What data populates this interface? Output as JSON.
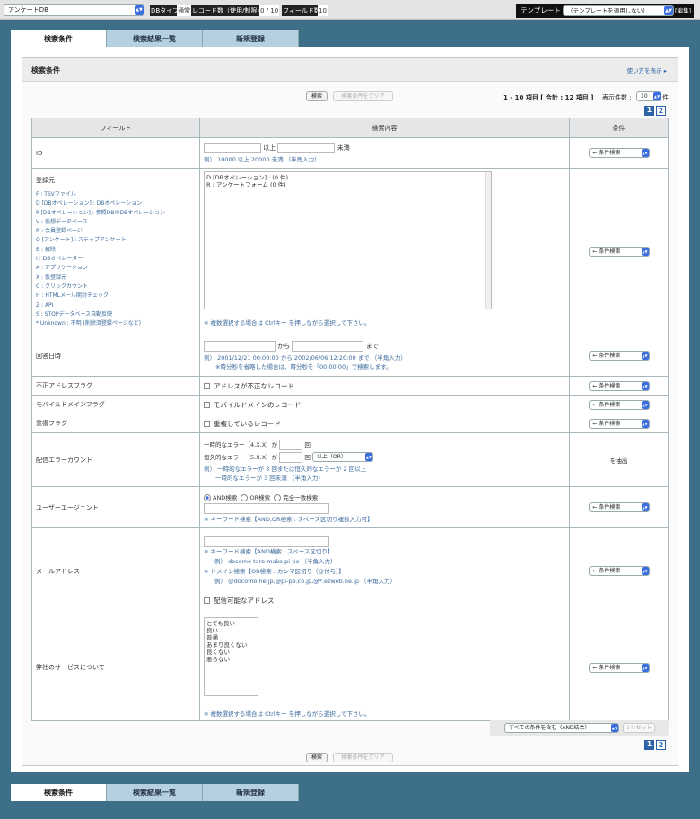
{
  "topbar": {
    "db_select": "アンケートDB",
    "db_type_label": "DBタイプ",
    "db_type_value": "通常",
    "record_count_label": "レコード数（使用/制限）",
    "record_count_value": "0 / 10",
    "field_count_label": "フィールド数",
    "field_count_value": "10",
    "template_label": "テンプレート",
    "template_select": "（テンプレートを適用しない）",
    "edit_label": "[編集]"
  },
  "tabs": [
    "検索条件",
    "検索結果一覧",
    "新規登録"
  ],
  "panel": {
    "title": "検索条件",
    "help_link": "使い方を表示 ▸",
    "search_button": "検索",
    "clear_button": "検索条件をクリア",
    "pager_summary": "1 - 10 項目 [ 合計 : 12 項目 ]",
    "display_count_label": "表示件数 :",
    "display_count_value": "10",
    "display_count_unit": "件",
    "pages": [
      "1",
      "2"
    ]
  },
  "table": {
    "headers": [
      "フィールド",
      "検索内容",
      "条件"
    ],
    "condition_search": "← 条件検索",
    "rows": {
      "id": {
        "label": "ID",
        "from_suffix": "以上",
        "to_suffix": "未満",
        "example": "例）  10000 以上 20000 未満 （半角入力）"
      },
      "source": {
        "label": "登録元",
        "legend": [
          "F : TSVファイル",
          "D [DBオペレーション] : DBオペレーション",
          "P [DBオペレーション] : 参照DBのDBオペレーション",
          "V : 仮想データベース",
          "R : 会員登録ページ",
          "Q [アンケート] : ステップアンケート",
          "B : 解除",
          "I : DBオペレーター",
          "A : アプリケーション",
          "X : 仮登録元",
          "C : クリックカウント",
          "H : HTMLメール開封チェック",
          "Z : API",
          "S : STOPデータベース自動反映",
          "* Unknown : 不明 (削除済登録ページなど)"
        ],
        "options": [
          "D [DBオペレーション] : (0 件)",
          "R : アンケートフォーム (0 件)"
        ],
        "note": "※ 複数選択する場合は Ctrlキー を押しながら選択して下さい。"
      },
      "reply_date": {
        "label": "回答日時",
        "mid": "から",
        "end": "まで",
        "example": "例） 2001/12/21 00:00:00 から 2002/06/06 12:20:00 まで （半角入力）",
        "note": "※時分秒を省略した場合は、時分秒を「00:00:00」で検索します。"
      },
      "invalid_addr": {
        "label": "不正アドレスフラグ",
        "checkbox": "アドレスが不正なレコード"
      },
      "mobile_domain": {
        "label": "モバイルドメインフラグ",
        "checkbox": "モバイルドメインのレコード"
      },
      "duplicate": {
        "label": "重複フラグ",
        "checkbox": "重複しているレコード"
      },
      "bounce": {
        "label": "配信エラーカウント",
        "line1_prefix": "一時的なエラー（4.X.X）が",
        "line1_unit": "回",
        "line2_prefix": "恒久的なエラー（5.X.X）が",
        "line2_unit": "回",
        "op_select": "以上（OR）",
        "example1": "例） 一時的なエラーが 3 回または恒久的なエラーが 2 回以上",
        "example2": "一時的なエラーが 3 回未満 （半角入力）",
        "condition": "を抽出"
      },
      "ua": {
        "label": "ユーザーエージェント",
        "radio": [
          "AND検索",
          "OR検索",
          "完全一致検索"
        ],
        "hint": "※ キーワード検索【AND,OR検索 : スペース区切り複数入力可】"
      },
      "mail": {
        "label": "メールアドレス",
        "hint1": "※ キーワード検索【AND検索 : スペース区切り】",
        "ex1": "例）  docomo taro mako pi-pe （半角入力）",
        "hint2": "※ ドメイン検索【OR検索 : カンマ区切り（@付与）】",
        "ex2": "例）  @docomo.ne.jp,@pi-pe.co.jp,@*.ezweb.ne.jp （半角入力）",
        "checkbox": "配信可能なアドレス"
      },
      "service": {
        "label": "弊社のサービスについて",
        "options": [
          "とても良い",
          "良い",
          "普通",
          "あまり良くない",
          "良くない",
          "悪らない"
        ],
        "note": "※ 複数選択する場合は Ctrlキー を押しながら選択して下さい。"
      }
    }
  },
  "footer": {
    "match_select": "すべての条件を含む（AND結合）",
    "reset_button": "↓リセット"
  }
}
